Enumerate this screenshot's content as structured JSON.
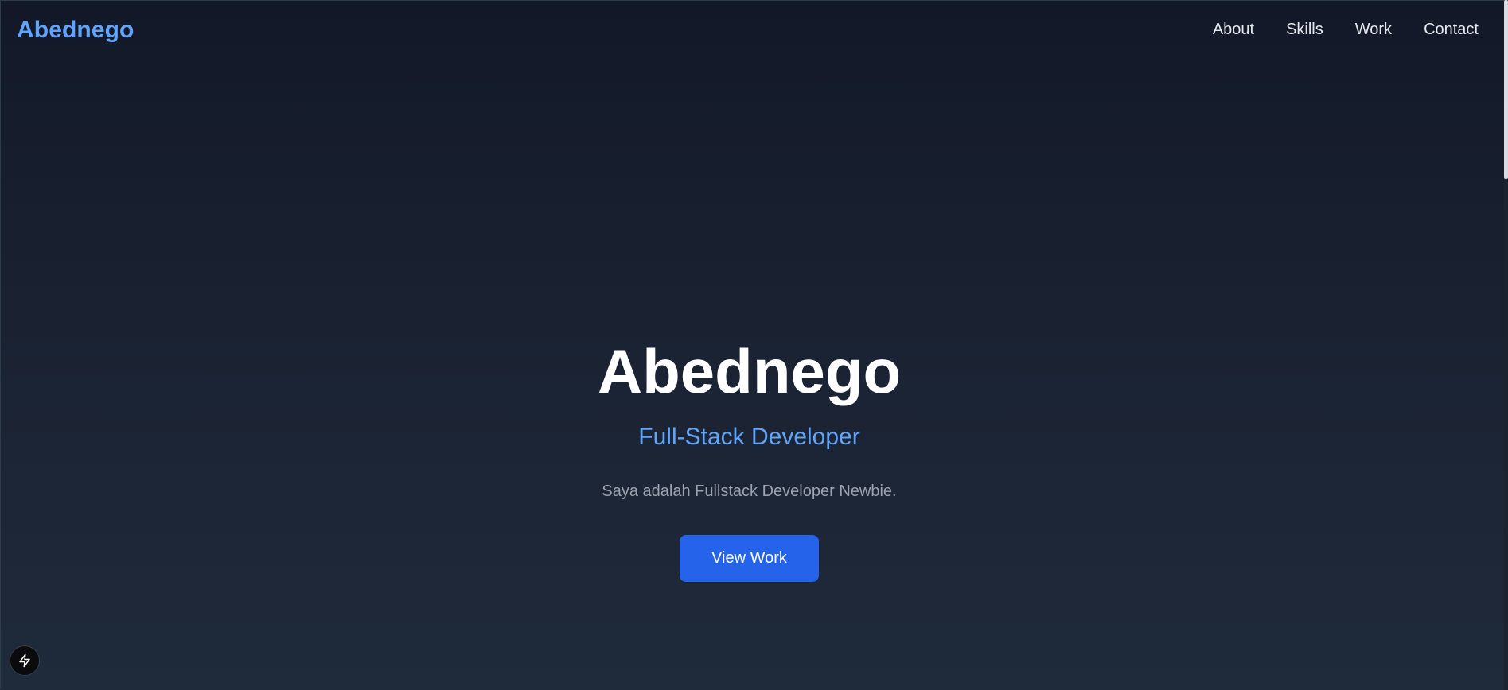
{
  "navbar": {
    "brand": "Abednego",
    "links": [
      {
        "label": "About"
      },
      {
        "label": "Skills"
      },
      {
        "label": "Work"
      },
      {
        "label": "Contact"
      }
    ]
  },
  "hero": {
    "title": "Abednego",
    "subtitle": "Full-Stack Developer",
    "description": "Saya adalah Fullstack Developer Newbie.",
    "cta_label": "View Work"
  },
  "devtools": {
    "icon": "lightning-bolt-icon"
  },
  "colors": {
    "accent": "#60a5fa",
    "button": "#2563eb",
    "background_top": "#121828",
    "background_bottom": "#1f2a3a",
    "text_muted": "#9ca3af"
  }
}
